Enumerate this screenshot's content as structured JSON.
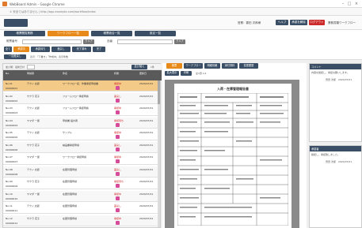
{
  "window": {
    "title": "WebBoard Admin - Google Chrome",
    "url": "① 安全ではありません | http://app.example.com/workflow/index"
  },
  "header": {
    "user_label": "営業：雲田 次郎様",
    "btn_help": "ヘルプ",
    "btn_approve": "承認を解除",
    "btn_logout": "ログアウト",
    "tail_label": "業務書類ワークフロー"
  },
  "menu": {
    "items": [
      "帳票閲覧業務",
      "ワークフロー一覧",
      "帳票総合一覧",
      "設定一覧"
    ]
  },
  "search": {
    "label1": "帳票番号",
    "btn1": "クリア",
    "label2": "品番",
    "btn2": "クリア"
  },
  "toolbar": {
    "items": [
      "全て",
      "承認中",
      "承認待ち",
      "差戻し",
      "完了済み",
      "完了"
    ]
  },
  "row4": {
    "btn": "一括差戻し",
    "text": "表示：「下書き」「作成中」表示件数"
  },
  "list": {
    "filter_label": "並び順：最新日付",
    "count_label": "1件",
    "sort_btn": "並び替え",
    "headers": [
      "No.",
      "申請者",
      "件名",
      "状態",
      "更新日"
    ],
    "rows": [
      {
        "no": "No.01",
        "code": "00000001",
        "applicant": "テクノ 太郎",
        "title": "ワークフロー名：作業承認申請書",
        "status": "承認中",
        "date": "2020/07/01"
      },
      {
        "no": "No.02",
        "code": "00000002",
        "applicant": "サクラ 花子",
        "title": "フォームフロー承認申請",
        "status": "差戻し",
        "date": "2020/07/01"
      },
      {
        "no": "No.03",
        "code": "00000003",
        "applicant": "テクノ 太郎",
        "title": "フォームフロー承認申請",
        "status": "承認中",
        "date": "2020/07/01"
      },
      {
        "no": "No.04",
        "code": "00000004",
        "applicant": "ヤマダ 一郎",
        "title": "申請書 設計者",
        "status": "承認待ち",
        "date": "2020/07/01"
      },
      {
        "no": "No.05",
        "code": "00000005",
        "applicant": "テクノ 太郎",
        "title": "サンプル",
        "status": "承認中",
        "date": "2020/07/01"
      },
      {
        "no": "No.06",
        "code": "00000006",
        "applicant": "サクラ 花子",
        "title": "納品書承認申請",
        "status": "差戻し",
        "date": "2020/07/01"
      },
      {
        "no": "No.07",
        "code": "00000007",
        "applicant": "ヤマダ 一郎",
        "title": "ワークフロー承認申請",
        "status": "承認中",
        "date": "2020/07/01"
      },
      {
        "no": "No.08",
        "code": "00000008",
        "applicant": "テクノ 太郎",
        "title": "在庫管理申請",
        "status": "差戻し",
        "date": "2020/07/01"
      },
      {
        "no": "No.09",
        "code": "00000009",
        "applicant": "サクラ 花子",
        "title": "在庫管理申請",
        "status": "承認待ち",
        "date": "2020/07/01"
      },
      {
        "no": "No.10",
        "code": "00000010",
        "applicant": "ヤマダ 一郎",
        "title": "在庫管理申請",
        "status": "承認中",
        "date": "2020/07/01"
      },
      {
        "no": "No.11",
        "code": "00000011",
        "applicant": "テクノ 太郎",
        "title": "在庫管理申請",
        "status": "差戻し",
        "date": "2020/07/01"
      },
      {
        "no": "No.12",
        "code": "00000012",
        "applicant": "サクラ 花子",
        "title": "在庫管理申請",
        "status": "承認中",
        "date": "2020/07/01"
      }
    ]
  },
  "viewer": {
    "tabs": [
      "帳票",
      "ワークフロー",
      "明細情報",
      "添付資料",
      "変更履歴"
    ],
    "btn_zoom": "拡大表示",
    "btn_print": "印刷",
    "page_label": "全1頁 1/1",
    "doc_title": "入荷・在庫管理報告書"
  },
  "right": {
    "comment_title": "コメント",
    "comment_text": "内容を確認し、承認お願いします。",
    "comment_meta": "雲田 次郎　2020/07/01",
    "history_title": "承認者",
    "history_text": "確認し、承認致しました。",
    "history_meta": "雲田 次郎　2020/07/01"
  },
  "colors": {
    "accent": "#e88a1a",
    "nav": "#3a4f66",
    "selected_row": "#f3ca88",
    "status": "#d02020",
    "pink": "#d64c9a"
  }
}
